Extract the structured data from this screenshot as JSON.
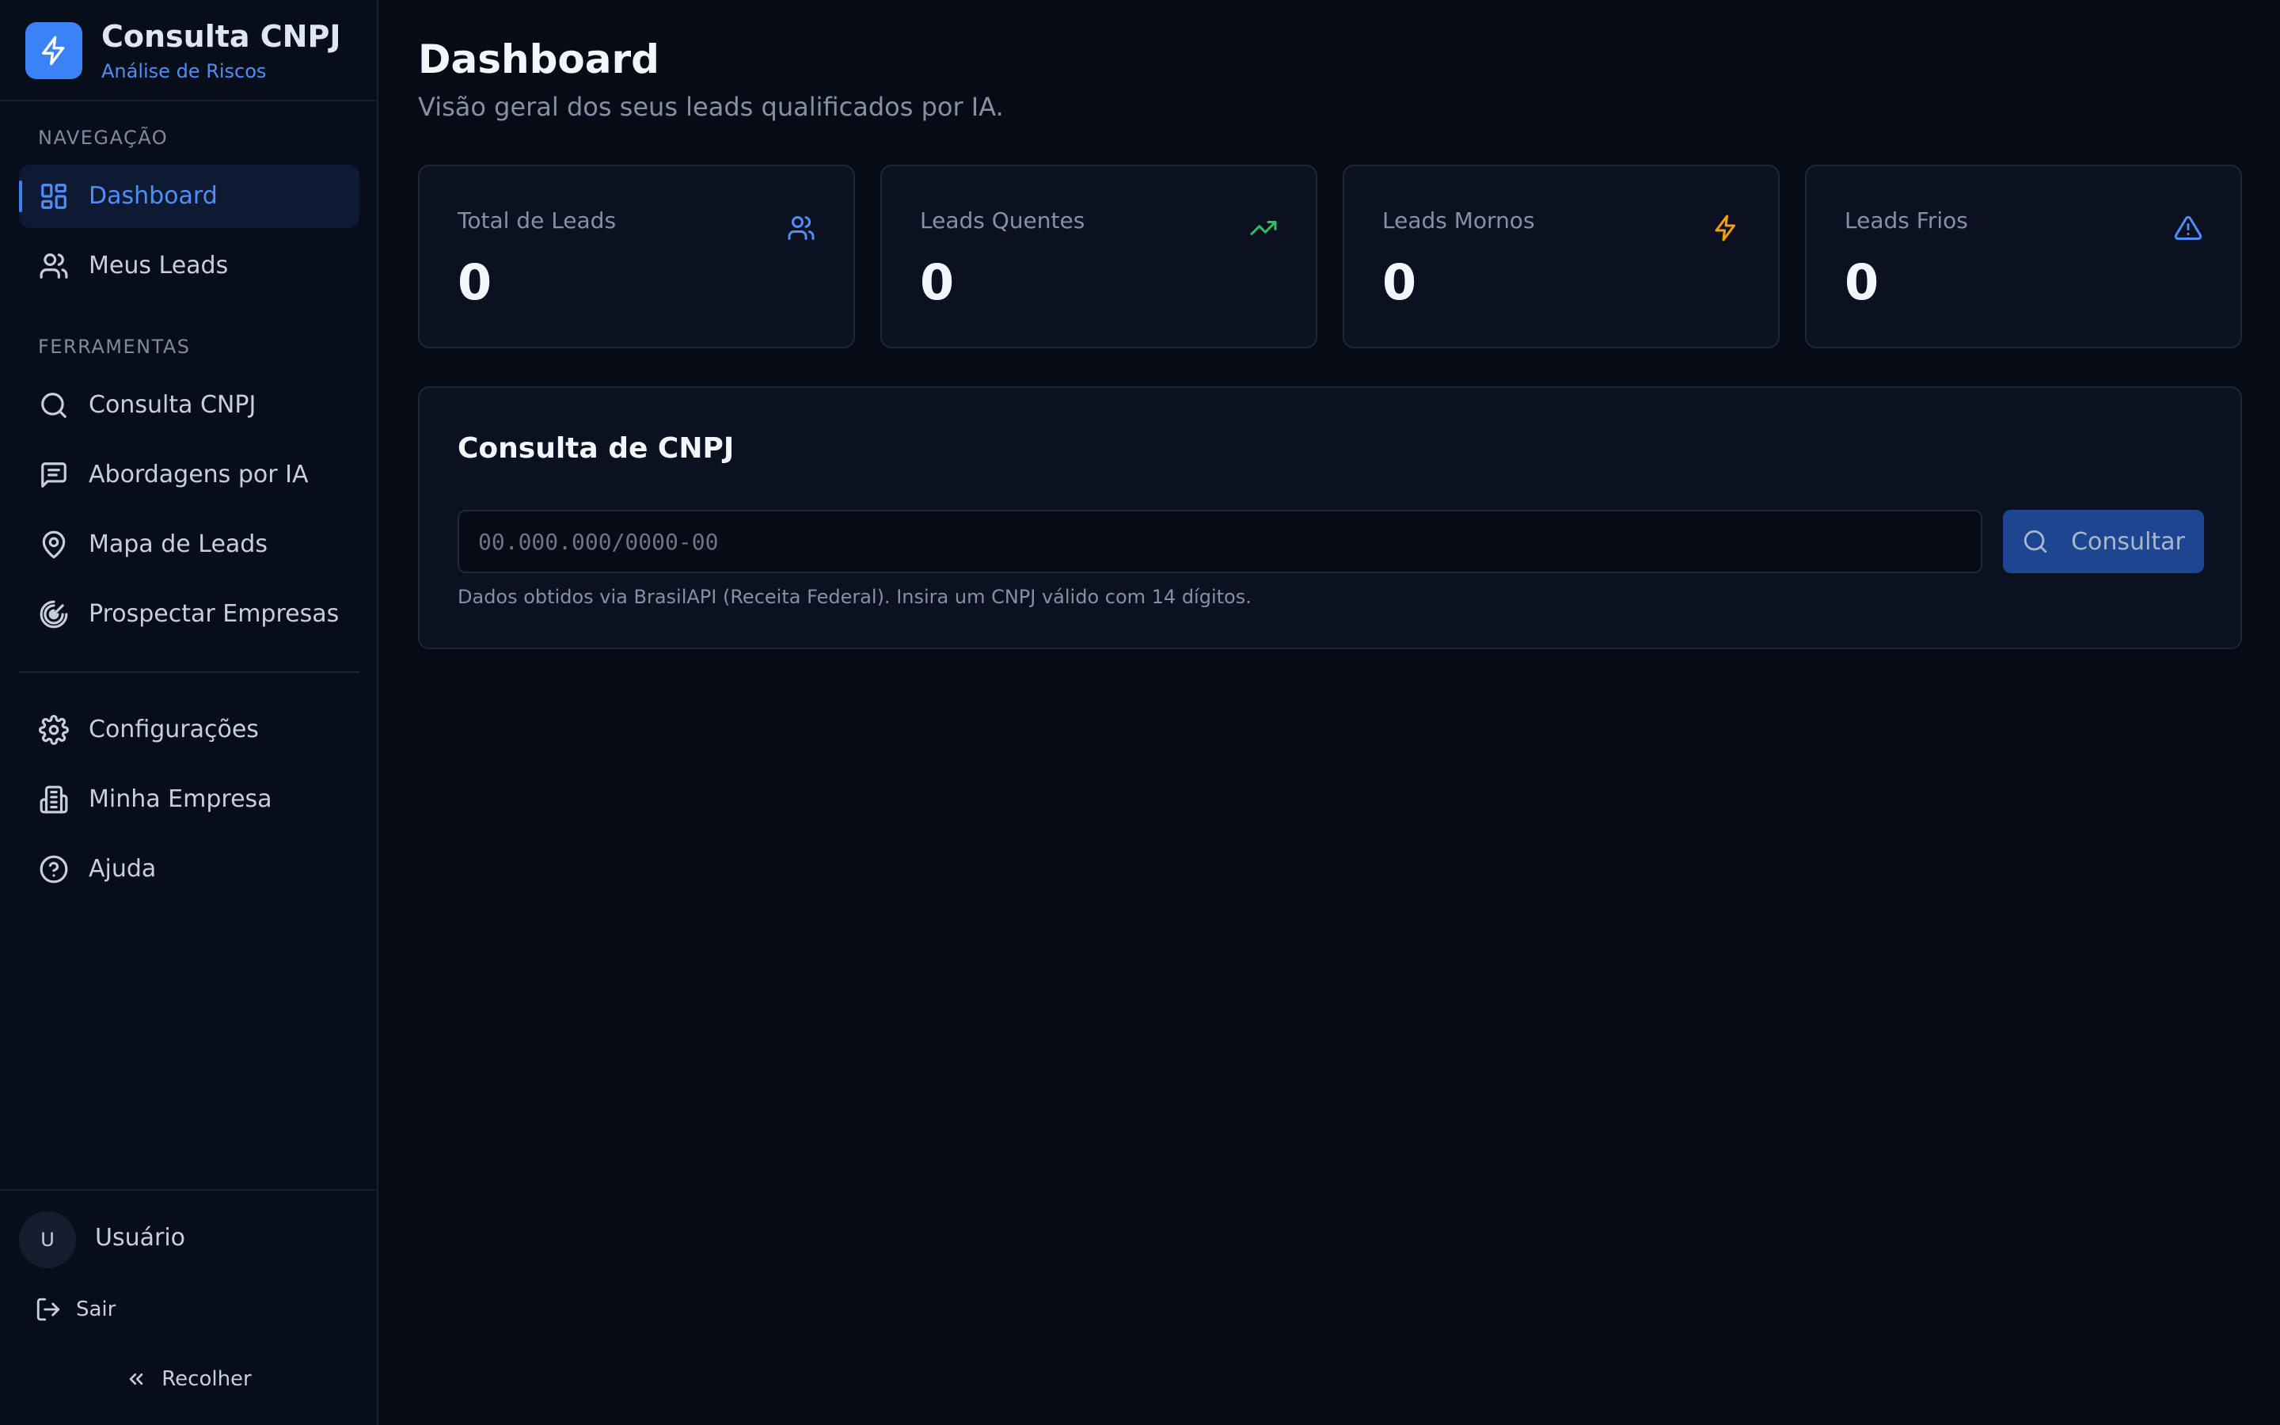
{
  "brand": {
    "title": "Consulta CNPJ",
    "subtitle": "Análise de Riscos",
    "logo_icon": "bolt-icon",
    "accent_color": "#3b82f6"
  },
  "sidebar": {
    "nav_section_label": "NAVEGAÇÃO",
    "nav_items": [
      {
        "label": "Dashboard",
        "icon": "dashboard-grid-icon",
        "active": true
      },
      {
        "label": "Meus Leads",
        "icon": "users-icon",
        "active": false
      }
    ],
    "tools_section_label": "FERRAMENTAS",
    "tool_items": [
      {
        "label": "Consulta CNPJ",
        "icon": "search-icon"
      },
      {
        "label": "Abordagens por IA",
        "icon": "message-icon"
      },
      {
        "label": "Mapa de Leads",
        "icon": "map-pin-icon"
      },
      {
        "label": "Prospectar Empresas",
        "icon": "radar-icon"
      }
    ],
    "settings_items": [
      {
        "label": "Configurações",
        "icon": "gear-icon"
      },
      {
        "label": "Minha Empresa",
        "icon": "building-icon"
      },
      {
        "label": "Ajuda",
        "icon": "help-circle-icon"
      }
    ],
    "user": {
      "initial": "U",
      "name": "Usuário"
    },
    "logout_label": "Sair",
    "collapse_label": "Recolher"
  },
  "main": {
    "title": "Dashboard",
    "subtitle": "Visão geral dos seus leads qualificados por IA.",
    "stats": [
      {
        "label": "Total de Leads",
        "value": "0",
        "icon": "users-icon",
        "color": "#4f8ef7"
      },
      {
        "label": "Leads Quentes",
        "value": "0",
        "icon": "trending-up-icon",
        "color": "#22c55e"
      },
      {
        "label": "Leads Mornos",
        "value": "0",
        "icon": "bolt-icon",
        "color": "#f59e0b"
      },
      {
        "label": "Leads Frios",
        "value": "0",
        "icon": "alert-triangle-icon",
        "color": "#4f8ef7"
      }
    ],
    "query": {
      "title": "Consulta de CNPJ",
      "input_value": "",
      "input_placeholder": "00.000.000/0000-00",
      "button_label": "Consultar",
      "help_text": "Dados obtidos via BrasilAPI (Receita Federal). Insira um CNPJ válido com 14 dígitos."
    }
  }
}
